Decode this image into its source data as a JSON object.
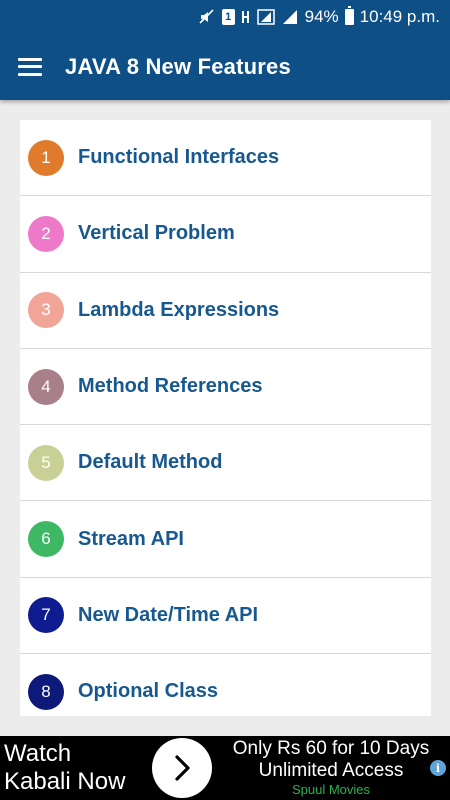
{
  "status_bar": {
    "battery_percent": "94%",
    "battery_level": 0.94,
    "time": "10:49 p.m.",
    "sim_label": "1",
    "icons": [
      "mute-icon",
      "sim-icon",
      "hd-icon",
      "signal-icon",
      "signal-icon",
      "battery-icon"
    ]
  },
  "app_bar": {
    "title": "JAVA 8 New Features",
    "menu_icon": "hamburger-menu-icon",
    "background": "#0e4f86"
  },
  "topics": [
    {
      "number": "1",
      "label": "Functional Interfaces",
      "color": "#e07b2c"
    },
    {
      "number": "2",
      "label": "Vertical Problem",
      "color": "#ef79c9"
    },
    {
      "number": "3",
      "label": "Lambda Expressions",
      "color": "#f0a597"
    },
    {
      "number": "4",
      "label": "Method References",
      "color": "#a88089"
    },
    {
      "number": "5",
      "label": "Default Method",
      "color": "#c8d096"
    },
    {
      "number": "6",
      "label": "Stream API",
      "color": "#3fb866"
    },
    {
      "number": "7",
      "label": "New Date/Time API",
      "color": "#0e1c8f"
    },
    {
      "number": "8",
      "label": "Optional Class",
      "color": "#0e1a7a"
    }
  ],
  "ad": {
    "left_text_1": "Watch",
    "left_text_2": "Kabali Now",
    "line1": "Only Rs 60 for 10 Days",
    "line2": "Unlimited Access",
    "line3": "Spuul Movies",
    "arrow_icon": "chevron-right-icon",
    "info_icon": "info-icon",
    "info_glyph": "i"
  }
}
